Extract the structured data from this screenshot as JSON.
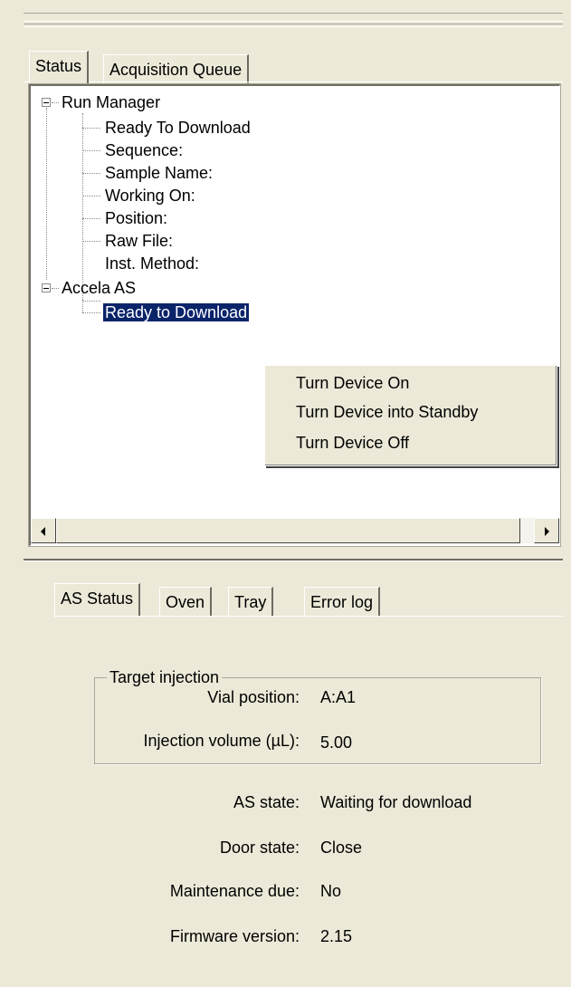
{
  "top_tabs": [
    "Status",
    "Acquisition Queue"
  ],
  "tree": {
    "run_manager": {
      "label": "Run Manager",
      "children": [
        "Ready To Download",
        "Sequence:",
        "Sample Name:",
        "Working On:",
        "Position:",
        "Raw File:",
        "Inst. Method:"
      ]
    },
    "accela": {
      "label": "Accela  AS",
      "children": [
        "Ready to Download"
      ]
    }
  },
  "context_menu": [
    "Turn Device On",
    "Turn Device into Standby",
    "Turn Device Off"
  ],
  "bottom_tabs": [
    "AS Status",
    "Oven",
    "Tray",
    "Error log"
  ],
  "target_injection": {
    "title": "Target injection",
    "rows": [
      {
        "label": "Vial position:",
        "value": "A:A1"
      },
      {
        "label": "Injection volume (µL):",
        "value": "5.00"
      }
    ]
  },
  "status_rows": [
    {
      "label": "AS state:",
      "value": "Waiting for download"
    },
    {
      "label": "Door state:",
      "value": "Close"
    },
    {
      "label": "Maintenance due:",
      "value": "No"
    },
    {
      "label": "Firmware version:",
      "value": "2.15"
    }
  ]
}
